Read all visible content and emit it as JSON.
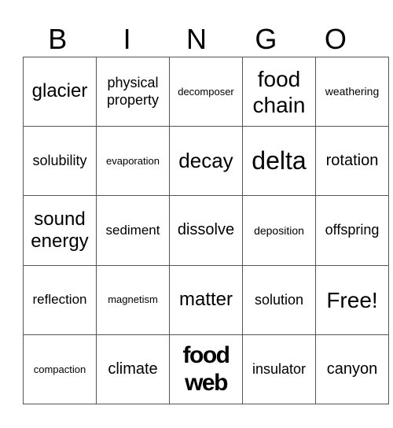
{
  "header": [
    "B",
    "I",
    "N",
    "G",
    "O"
  ],
  "cells": [
    [
      "glacier",
      "physical property",
      "decomposer",
      "food chain",
      "weathering"
    ],
    [
      "solubility",
      "evaporation",
      "decay",
      "delta",
      "rotation"
    ],
    [
      "sound energy",
      "sediment",
      "dissolve",
      "deposition",
      "offspring"
    ],
    [
      "reflection",
      "magnetism",
      "matter",
      "solution",
      "Free!"
    ],
    [
      "compaction",
      "climate",
      "food web",
      "insulator",
      "canyon"
    ]
  ]
}
